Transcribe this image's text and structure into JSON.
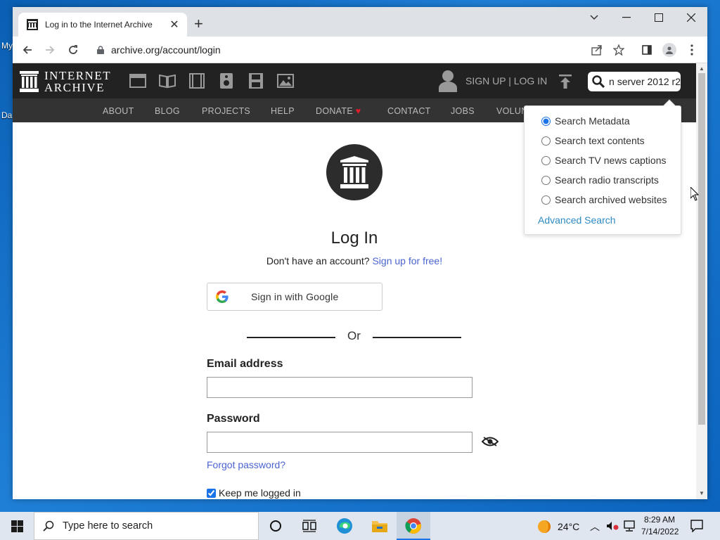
{
  "browser": {
    "tab_title": "Log in to the Internet Archive",
    "url": "archive.org/account/login"
  },
  "ia_header": {
    "logo_line1": "INTERNET",
    "logo_line2": "ARCHIVE",
    "auth_links": "SIGN UP | LOG IN",
    "search_value": "n server 2012 r2",
    "nav": [
      "ABOUT",
      "BLOG",
      "PROJECTS",
      "HELP",
      "DONATE",
      "CONTACT",
      "JOBS",
      "VOLUN"
    ]
  },
  "search_dropdown": {
    "options": [
      "Search Metadata",
      "Search text contents",
      "Search TV news captions",
      "Search radio transcripts",
      "Search archived websites"
    ],
    "selected": "Search Metadata",
    "advanced": "Advanced Search"
  },
  "login": {
    "title": "Log In",
    "no_account": "Don't have an account?",
    "signup_link": "Sign up for free!",
    "google_btn": "Sign in with Google",
    "or": "Or",
    "email_label": "Email address",
    "email_value": "",
    "password_label": "Password",
    "password_value": "",
    "forgot": "Forgot password?",
    "keep_logged": "Keep me logged in",
    "keep_checked": true
  },
  "taskbar": {
    "search_placeholder": "Type here to search",
    "weather": "24°C",
    "time": "8:29 AM",
    "date": "7/14/2022"
  },
  "colors": {
    "ia_dark": "#222222",
    "ia_nav": "#333333",
    "link_blue": "#4b64d1",
    "donate_heart": "#e11d2a"
  }
}
